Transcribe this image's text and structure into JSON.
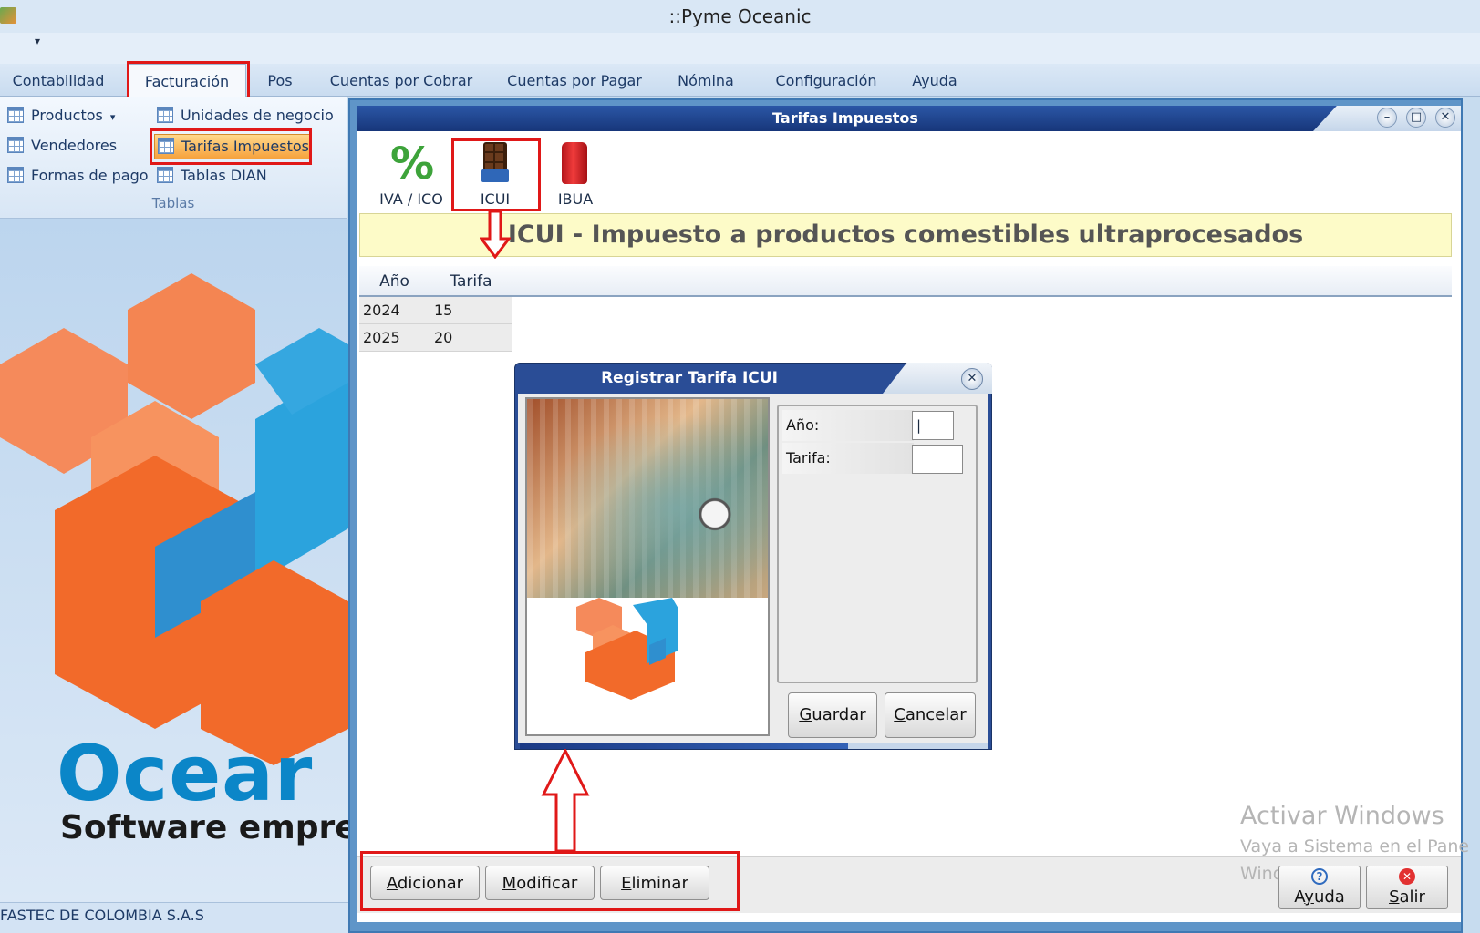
{
  "window": {
    "title": "::Pyme Oceanic"
  },
  "ribbon": {
    "tabs": [
      "Contabilidad",
      "Facturación",
      "Pos",
      "Cuentas por Cobrar",
      "Cuentas por Pagar",
      "Nómina",
      "Configuración",
      "Ayuda"
    ],
    "items": {
      "productos": "Productos",
      "vendedores": "Vendedores",
      "formas_pago": "Formas de pago",
      "unidades": "Unidades de negocio",
      "tarifas": "Tarifas Impuestos",
      "tablas_dian": "Tablas DIAN"
    },
    "group_label": "Tablas"
  },
  "background": {
    "brand": "Ocear",
    "tagline": "Software empre",
    "status": "FASTEC DE COLOMBIA S.A.S"
  },
  "tarifas_window": {
    "title": "Tarifas Impuestos",
    "toolbar": [
      "IVA / ICO",
      "ICUI",
      "IBUA"
    ],
    "banner": "ICUI - Impuesto a productos comestibles ultraprocesados",
    "columns": [
      "Año",
      "Tarifa"
    ],
    "rows": [
      {
        "year": "2024",
        "rate": "15"
      },
      {
        "year": "2025",
        "rate": "20"
      }
    ],
    "buttons": {
      "adicionar": {
        "u": "A",
        "rest": "dicionar"
      },
      "modificar": {
        "u": "M",
        "rest": "odificar"
      },
      "eliminar": {
        "u": "E",
        "rest": "liminar"
      },
      "ayuda": {
        "pre": "A",
        "u": "y",
        "rest": "uda"
      },
      "salir": {
        "u": "S",
        "rest": "alir"
      }
    }
  },
  "dialog": {
    "title": "Registrar Tarifa ICUI",
    "fields": {
      "anio_label": "Año:",
      "anio_value": "|",
      "tarifa_label": "Tarifa:",
      "tarifa_value": ""
    },
    "buttons": {
      "guardar": {
        "u": "G",
        "rest": "uardar"
      },
      "cancelar": {
        "u": "C",
        "rest": "ancelar"
      }
    }
  },
  "watermark": {
    "line1": "Activar Windows",
    "line2": "Vaya a Sistema en el Panel",
    "line3": "Windows"
  },
  "colors": {
    "highlight": "#e01818",
    "title_blue": "#17367a",
    "banner_bg": "#fdfbc8",
    "brand_blue": "#0b86c8",
    "brand_orange": "#f26a2a"
  }
}
